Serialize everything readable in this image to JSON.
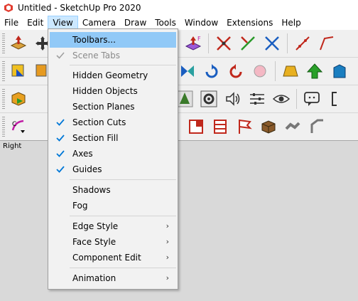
{
  "titlebar": {
    "title": "Untitled - SketchUp Pro 2020",
    "icon": "sketchup-logo-icon"
  },
  "menubar": [
    {
      "label": "File",
      "active": false
    },
    {
      "label": "Edit",
      "active": false
    },
    {
      "label": "View",
      "active": true
    },
    {
      "label": "Camera",
      "active": false
    },
    {
      "label": "Draw",
      "active": false
    },
    {
      "label": "Tools",
      "active": false
    },
    {
      "label": "Window",
      "active": false
    },
    {
      "label": "Extensions",
      "active": false
    },
    {
      "label": "Help",
      "active": false
    }
  ],
  "viewport": {
    "label": "Right",
    "background": "#d9d9d9"
  },
  "view_menu": {
    "items": [
      {
        "label": "Toolbars...",
        "highlighted": true
      },
      {
        "label": "Scene Tabs",
        "disabled": true,
        "checked": true
      },
      {
        "label": "Hidden Geometry"
      },
      {
        "label": "Hidden Objects"
      },
      {
        "label": "Section Planes"
      },
      {
        "label": "Section Cuts",
        "checked": true
      },
      {
        "label": "Section Fill",
        "checked": true
      },
      {
        "label": "Axes",
        "checked": true
      },
      {
        "label": "Guides",
        "checked": true
      },
      {
        "label": "Shadows"
      },
      {
        "label": "Fog"
      },
      {
        "label": "Edge Style",
        "submenu": true
      },
      {
        "label": "Face Style",
        "submenu": true
      },
      {
        "label": "Component Edit",
        "submenu": true
      },
      {
        "label": "Animation",
        "submenu": true
      }
    ],
    "submenu_glyph": "›"
  },
  "colors": {
    "menu_highlight": "#91c9f7",
    "menu_active": "#cce8ff",
    "check": "#0078d7"
  }
}
